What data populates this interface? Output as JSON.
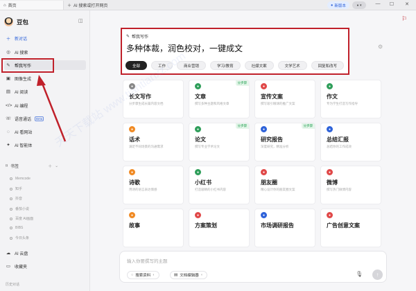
{
  "titlebar": {
    "home_tab": "首页",
    "new_tab": "AI 搜索或打开网页",
    "upgrade_label": "新版本",
    "user_label": "",
    "min": "—",
    "max": "☐",
    "close": "✕"
  },
  "sidebar": {
    "brand": "豆包",
    "items": [
      {
        "label": "新对话"
      },
      {
        "label": "AI 搜索"
      },
      {
        "label": "帮我写作"
      },
      {
        "label": "图像生成"
      },
      {
        "label": "AI 阅读"
      },
      {
        "label": "AI 编程"
      },
      {
        "label": "语音通话",
        "tag": "Beta"
      },
      {
        "label": "AI 看网站"
      },
      {
        "label": "AI 智能体"
      }
    ],
    "bookmarks_title": "书签",
    "bookmarks": [
      "Memcode",
      "知乎",
      "抖音",
      "番茄小说",
      "百度 AI画面",
      "BIBS",
      "今日头条"
    ],
    "cloud": "AI 云盘",
    "favorites": "收藏夹",
    "history": "历史对话"
  },
  "writing": {
    "small_title": "帮我写作",
    "headline": "多种体裁，润色校对，一键成文",
    "chips": [
      "全部",
      "工作",
      "商业营销",
      "学习/教育",
      "社媒文案",
      "文学艺术",
      "回复和改写"
    ]
  },
  "cards": [
    {
      "title": "长文写作",
      "desc": "分步骤生成长篇内容文档",
      "color": "#888",
      "badge": ""
    },
    {
      "title": "文章",
      "desc": "撰写多种主题和风格文章",
      "color": "#2f9e5a",
      "badge": "分步骤"
    },
    {
      "title": "宣传文案",
      "desc": "撰写吸引眼球的推广文案",
      "color": "#e04848",
      "badge": ""
    },
    {
      "title": "作文",
      "desc": "专为学生打造写作指导",
      "color": "#2f9e5a",
      "badge": ""
    },
    {
      "title": "话术",
      "desc": "满足不同场景的沟通需求",
      "color": "#f08a24",
      "badge": ""
    },
    {
      "title": "论文",
      "desc": "撰写专业学术论文",
      "color": "#2f9e5a",
      "badge": "分步骤"
    },
    {
      "title": "研究报告",
      "desc": "深度研究，精准分析",
      "color": "#2e62d9",
      "badge": "分步骤"
    },
    {
      "title": "总结汇报",
      "desc": "总结你的工作成效",
      "color": "#2e62d9",
      "badge": ""
    },
    {
      "title": "诗歌",
      "desc": "用诗的语言表达情感",
      "color": "#f08a24",
      "badge": ""
    },
    {
      "title": "小红书",
      "desc": "打造吸睛的小红书内容",
      "color": "#2f9e5a",
      "badge": ""
    },
    {
      "title": "朋友圈",
      "desc": "精心设计你的朋友圈文案",
      "color": "#e04848",
      "badge": ""
    },
    {
      "title": "微博",
      "desc": "撰写热门微博内容",
      "color": "#e04848",
      "badge": ""
    },
    {
      "title": "故事",
      "desc": "",
      "color": "#f08a24",
      "badge": ""
    },
    {
      "title": "方案策划",
      "desc": "",
      "color": "#e04848",
      "badge": ""
    },
    {
      "title": "市场调研报告",
      "desc": "",
      "color": "#2e62d9",
      "badge": ""
    },
    {
      "title": "广告创意文案",
      "desc": "",
      "color": "#e04848",
      "badge": ""
    }
  ],
  "composer": {
    "placeholder": "输入你要撰写的主题",
    "search_btn": "搜索资料",
    "doc_btn": "文档编辑器"
  },
  "watermark": "天天下载站 www.tiantianxz.com"
}
